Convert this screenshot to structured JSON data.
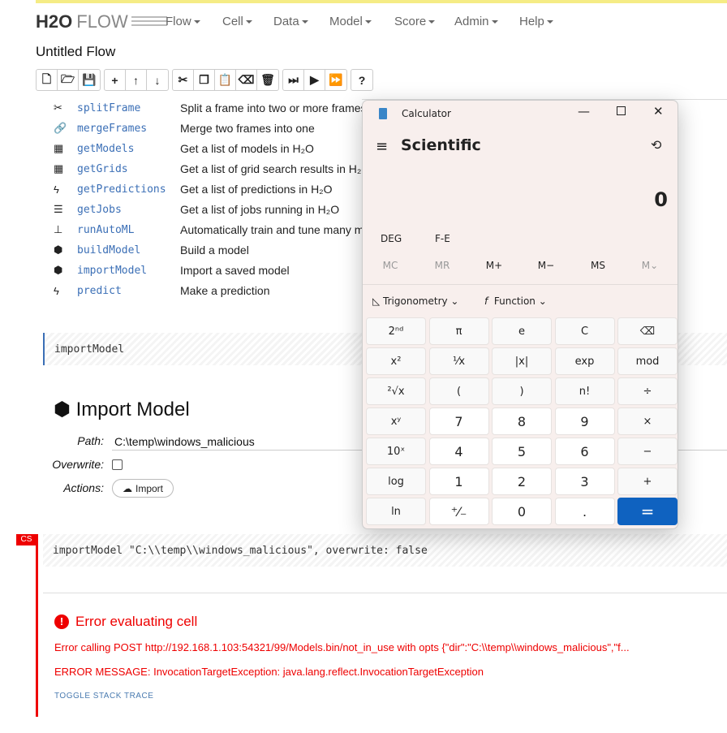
{
  "app": {
    "logo": "H2O",
    "logo_flow": "FLOW",
    "title": "Untitled Flow",
    "menu": [
      "Flow",
      "Cell",
      "Data",
      "Model",
      "Score",
      "Admin",
      "Help"
    ]
  },
  "toolbar": {
    "groups": [
      [
        "new-file",
        "open-folder",
        "save"
      ],
      [
        "add",
        "move-up",
        "move-down"
      ],
      [
        "cut",
        "copy",
        "paste",
        "erase",
        "delete"
      ],
      [
        "run-step",
        "run",
        "run-all"
      ],
      [
        "help"
      ]
    ]
  },
  "help_rows": [
    {
      "icon": "✂",
      "name": "splitFrame",
      "desc": "Split a frame into two or more frames"
    },
    {
      "icon": "🔗",
      "name": "mergeFrames",
      "desc": "Merge two frames into one"
    },
    {
      "icon": "▦",
      "name": "getModels",
      "desc": "Get a list of models in H₂O"
    },
    {
      "icon": "▦",
      "name": "getGrids",
      "desc": "Get a list of grid search results in H₂O"
    },
    {
      "icon": "ϟ",
      "name": "getPredictions",
      "desc": "Get a list of predictions in H₂O"
    },
    {
      "icon": "☰",
      "name": "getJobs",
      "desc": "Get a list of jobs running in H₂O"
    },
    {
      "icon": "⊥",
      "name": "runAutoML",
      "desc": "Automatically train and tune many models"
    },
    {
      "icon": "⬢",
      "name": "buildModel",
      "desc": "Build a model"
    },
    {
      "icon": "⬢",
      "name": "importModel",
      "desc": "Import a saved model"
    },
    {
      "icon": "ϟ",
      "name": "predict",
      "desc": "Make a prediction"
    }
  ],
  "cell1": "importModel",
  "import": {
    "heading": "Import Model",
    "path_label": "Path:",
    "path_value": "C:\\temp\\windows_malicious",
    "overwrite_label": "Overwrite:",
    "overwrite": false,
    "actions_label": "Actions:",
    "import_button": "Import"
  },
  "cell2": {
    "badge": "CS",
    "code": "importModel \"C:\\\\temp\\\\windows_malicious\", overwrite: false"
  },
  "error": {
    "heading": "Error evaluating cell",
    "line1": "Error calling POST http://192.168.1.103:54321/99/Models.bin/not_in_use with opts {\"dir\":\"C:\\\\temp\\\\windows_malicious\",\"f...",
    "line2": "ERROR MESSAGE: InvocationTargetException: java.lang.reflect.InvocationTargetException",
    "toggle": "TOGGLE STACK TRACE"
  },
  "calculator": {
    "title": "Calculator",
    "mode": "Scientific",
    "display": "0",
    "deg": "DEG",
    "fe": "F-E",
    "memory": [
      "MC",
      "MR",
      "M+",
      "M−",
      "MS",
      "M⌄"
    ],
    "trig": "Trigonometry",
    "func": "Function",
    "buttons": [
      [
        "2ⁿᵈ",
        "π",
        "e",
        "C",
        "⌫"
      ],
      [
        "x²",
        "¹⁄x",
        "|x|",
        "exp",
        "mod"
      ],
      [
        "²√x",
        "(",
        ")",
        "n!",
        "÷"
      ],
      [
        "xʸ",
        "7",
        "8",
        "9",
        "×"
      ],
      [
        "10ˣ",
        "4",
        "5",
        "6",
        "−"
      ],
      [
        "log",
        "1",
        "2",
        "3",
        "+"
      ],
      [
        "ln",
        "⁺⁄₋",
        "0",
        ".",
        "="
      ]
    ],
    "accent": "#0f62c0"
  }
}
